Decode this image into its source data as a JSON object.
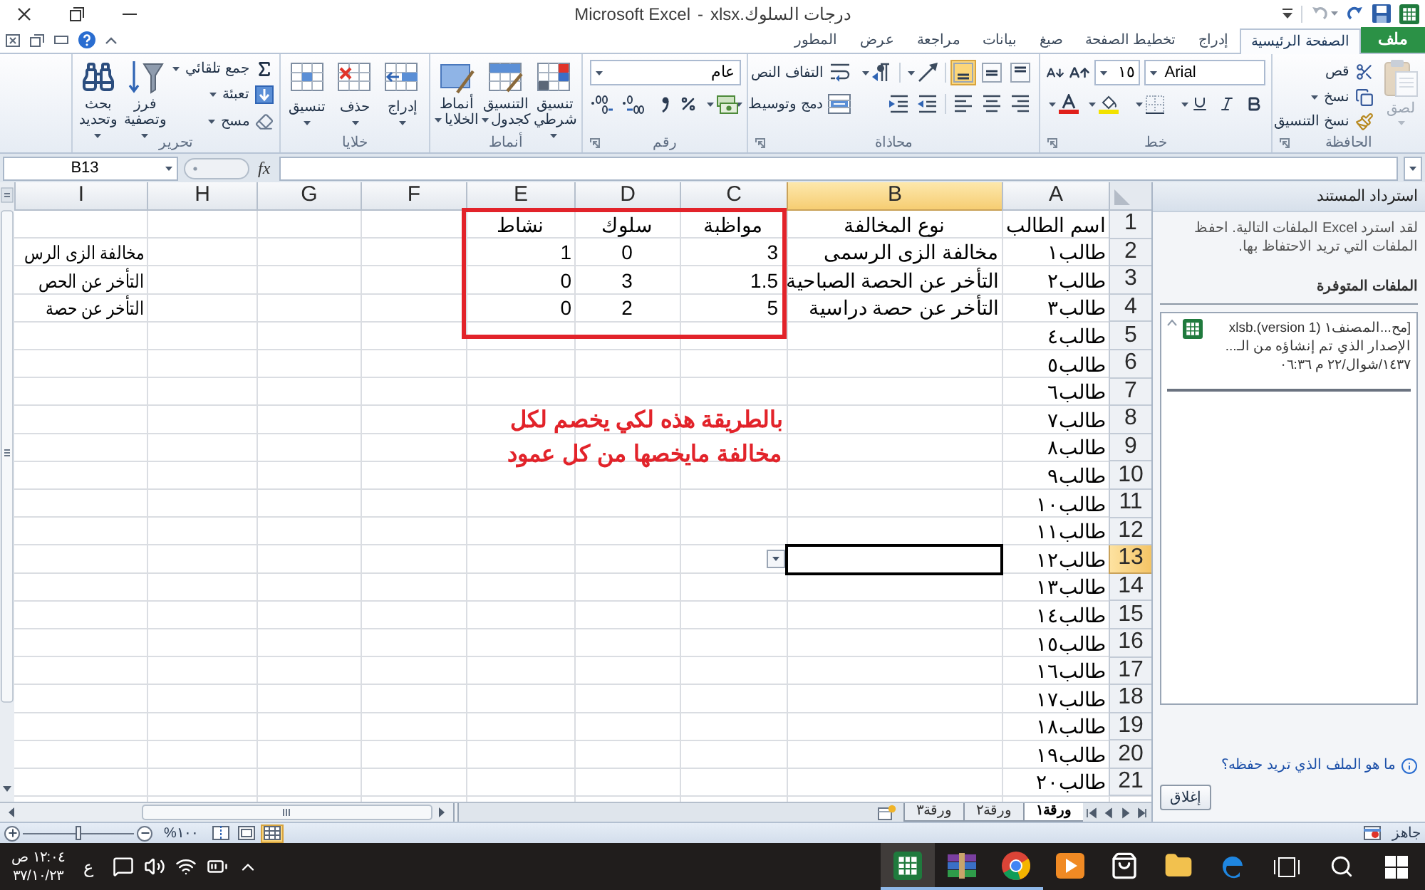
{
  "window": {
    "application": "Microsoft Excel",
    "separator": "-",
    "document_name": "درجات السلوك.xlsx"
  },
  "ribbon_tabs": [
    {
      "label": "ملف",
      "kind": "file",
      "selected": false
    },
    {
      "label": "الصفحة الرئيسية",
      "kind": "tab",
      "selected": true
    },
    {
      "label": "إدراج",
      "kind": "tab",
      "selected": false
    },
    {
      "label": "تخطيط الصفحة",
      "kind": "tab",
      "selected": false
    },
    {
      "label": "صيغ",
      "kind": "tab",
      "selected": false
    },
    {
      "label": "بيانات",
      "kind": "tab",
      "selected": false
    },
    {
      "label": "مراجعة",
      "kind": "tab",
      "selected": false
    },
    {
      "label": "عرض",
      "kind": "tab",
      "selected": false
    },
    {
      "label": "المطور",
      "kind": "tab",
      "selected": false
    }
  ],
  "ribbon": {
    "clipboard": {
      "label": "الحافظة",
      "paste": {
        "label": "لصق",
        "disabled": true
      },
      "cut": "قص",
      "copy": "نسخ",
      "format_painter": "نسخ التنسيق"
    },
    "font": {
      "label": "خط",
      "font_name": "Arial",
      "font_size": "١٥"
    },
    "alignment": {
      "label": "محاذاة",
      "vertical_align": [
        {
          "selected": false
        },
        {
          "selected": false
        },
        {
          "selected": true
        }
      ],
      "wrap_text": "التفاف النص",
      "merge_center": "دمج وتوسيط"
    },
    "number": {
      "label": "رقم",
      "format": "عام"
    },
    "styles": {
      "label": "أنماط",
      "conditional_formatting": "تنسيق شرطي",
      "format_as_table": "التنسيق كجدول",
      "cell_styles": "أنماط الخلايا"
    },
    "cells": {
      "label": "خلايا",
      "insert": "إدراج",
      "delete": "حذف",
      "format": "تنسيق"
    },
    "editing": {
      "label": "تحرير",
      "autosum": "جمع تلقائي",
      "fill": "تعبئة",
      "clear": "مسح",
      "sort_filter": "فرز وتصفية",
      "find_select": "بحث وتحديد"
    }
  },
  "formula_bar": {
    "name_box": "B13",
    "function_button": "fx"
  },
  "sheet": {
    "columns": [
      {
        "label": "A",
        "selected": false
      },
      {
        "label": "B",
        "selected": true
      },
      {
        "label": "C",
        "selected": false
      },
      {
        "label": "D",
        "selected": false
      },
      {
        "label": "E",
        "selected": false
      },
      {
        "label": "F",
        "selected": false
      },
      {
        "label": "G",
        "selected": false
      },
      {
        "label": "H",
        "selected": false
      },
      {
        "label": "I",
        "selected": false
      }
    ],
    "rows": [
      {
        "number": "1",
        "selected": false,
        "a": "اسم الطالب",
        "b": "نوع المخالفة",
        "c": "مواظبة",
        "d": "سلوك",
        "e": "نشاط"
      },
      {
        "number": "2",
        "selected": false,
        "a": "طالب١",
        "b": "مخالفة الزى الرسمى",
        "c": "3",
        "d": "0",
        "e": "1",
        "i": "مخالفة الزى الرس"
      },
      {
        "number": "3",
        "selected": false,
        "a": "طالب٢",
        "b": "التأخر عن الحصة الصباحية",
        "c": "1.5",
        "d": "3",
        "e": "0",
        "i": "التأخر عن الحص"
      },
      {
        "number": "4",
        "selected": false,
        "a": "طالب٣",
        "b": "التأخر عن حصة دراسية",
        "c": "5",
        "d": "2",
        "e": "0",
        "i": "التأخر عن حصة"
      },
      {
        "number": "5",
        "selected": false,
        "a": "طالب٤"
      },
      {
        "number": "6",
        "selected": false,
        "a": "طالب٥"
      },
      {
        "number": "7",
        "selected": false,
        "a": "طالب٦"
      },
      {
        "number": "8",
        "selected": false,
        "a": "طالب٧"
      },
      {
        "number": "9",
        "selected": false,
        "a": "طالب٨"
      },
      {
        "number": "10",
        "selected": false,
        "a": "طالب٩"
      },
      {
        "number": "11",
        "selected": false,
        "a": "طالب١٠"
      },
      {
        "number": "12",
        "selected": false,
        "a": "طالب١١"
      },
      {
        "number": "13",
        "selected": true,
        "a": "طالب١٢"
      },
      {
        "number": "14",
        "selected": false,
        "a": "طالب١٣"
      },
      {
        "number": "15",
        "selected": false,
        "a": "طالب١٤"
      },
      {
        "number": "16",
        "selected": false,
        "a": "طالب١٥"
      },
      {
        "number": "17",
        "selected": false,
        "a": "طالب١٦"
      },
      {
        "number": "18",
        "selected": false,
        "a": "طالب١٧"
      },
      {
        "number": "19",
        "selected": false,
        "a": "طالب١٨"
      },
      {
        "number": "20",
        "selected": false,
        "a": "طالب١٩"
      },
      {
        "number": "21",
        "selected": false,
        "a": "طالب٢٠"
      }
    ]
  },
  "annotation": {
    "lines": [
      "بالطريقة هذه لكي يخصم لكل",
      "مخالفة مايخصها من كل عمود"
    ]
  },
  "sheet_tabs": [
    {
      "label": "ورقة١",
      "selected": true
    },
    {
      "label": "ورقة٢",
      "selected": false
    },
    {
      "label": "ورقة٣",
      "selected": false
    }
  ],
  "recovery_pane": {
    "title": "استرداد المستند",
    "message": "لقد استرد Excel الملفات التالية. احفظ الملفات التي تريد الاحتفاظ بها.",
    "section": "الملفات المتوفرة",
    "files": [
      {
        "name": "[مح...المصنف١ (version 1).xlsb",
        "description": "الإصدار الذي تم إنشاؤه من الـ...",
        "date": "١٤٣٧/شوال/٢٢ م ٠٦:٣٦"
      }
    ],
    "help_link": "ما هو الملف الذي تريد حفظه؟",
    "close_button": "إغلاق"
  },
  "status_bar": {
    "status": "جاهز",
    "zoom": {
      "label": "%١٠٠",
      "level": 0.5
    },
    "views": [
      {
        "selected": false
      },
      {
        "selected": false
      },
      {
        "selected": true
      }
    ]
  },
  "taskbar": {
    "time": "١٢:٠٤ ص",
    "date": "٣٧/١٠/٢٣",
    "language": "ع",
    "apps": [
      {
        "selected": true,
        "running": true
      },
      {
        "selected": false,
        "running": true
      },
      {
        "selected": false,
        "running": true
      },
      {
        "selected": false,
        "running": false
      },
      {
        "selected": false,
        "running": false
      },
      {
        "selected": false,
        "running": false
      },
      {
        "selected": false,
        "running": false
      }
    ]
  }
}
